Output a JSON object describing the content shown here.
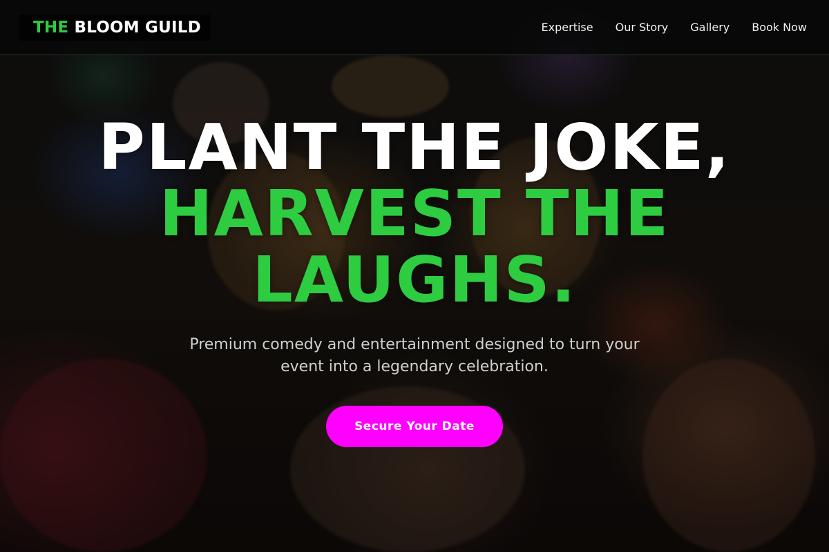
{
  "brand": {
    "accent_word": "THE",
    "rest_words": "BLOOM GUILD",
    "accent_color": "#2ecc40"
  },
  "nav": {
    "items": [
      {
        "label": "Expertise"
      },
      {
        "label": "Our Story"
      },
      {
        "label": "Gallery"
      },
      {
        "label": "Book Now"
      }
    ]
  },
  "hero": {
    "headline_line1": "PLANT THE JOKE,",
    "headline_line2": "HARVEST THE LAUGHS.",
    "subtitle": "Premium comedy and entertainment designed to turn your event into a legendary celebration.",
    "cta_label": "Secure Your Date",
    "cta_color": "#ff00ff",
    "background_image": "party-toast-photo"
  }
}
